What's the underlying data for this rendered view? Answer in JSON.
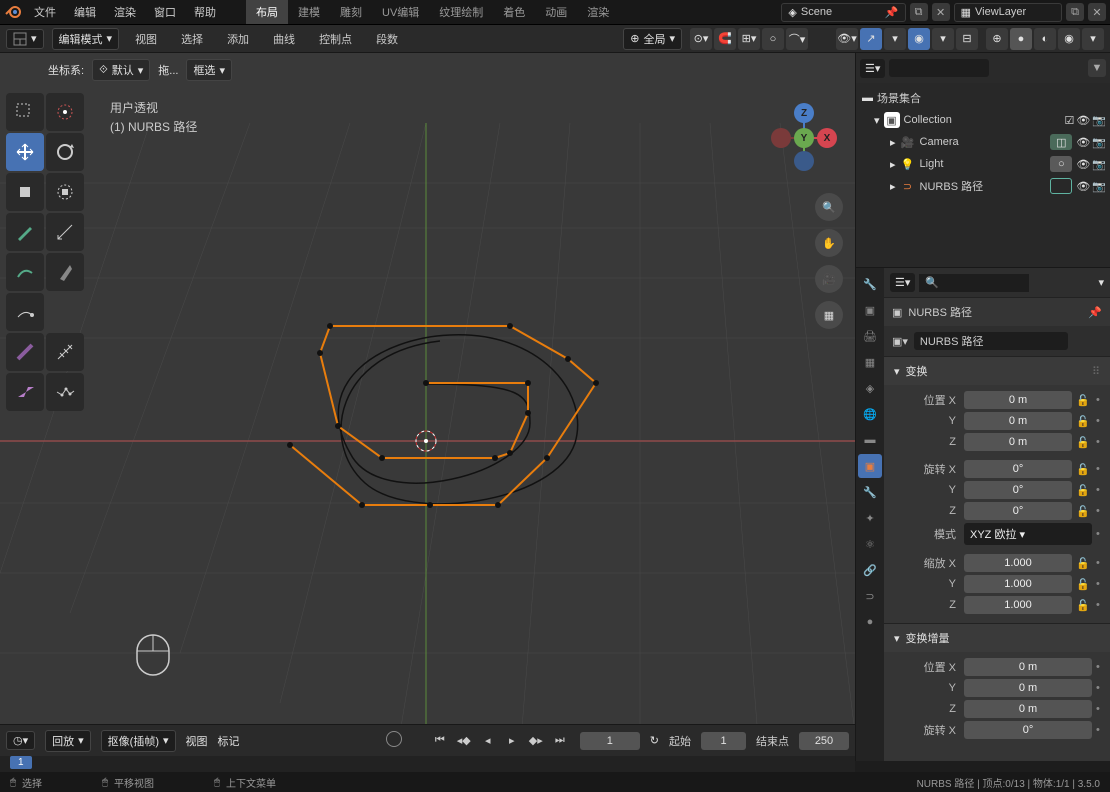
{
  "header": {
    "menu": [
      "文件",
      "编辑",
      "渲染",
      "窗口",
      "帮助"
    ],
    "tabs": [
      "布局",
      "建模",
      "雕刻",
      "UV编辑",
      "纹理绘制",
      "着色",
      "动画",
      "渲染"
    ],
    "active_tab": 0,
    "scene_label": "Scene",
    "viewlayer_label": "ViewLayer"
  },
  "toolbar": {
    "mode": "编辑模式",
    "items": [
      "视图",
      "选择",
      "添加",
      "曲线",
      "控制点",
      "段数"
    ],
    "orientation": "全局",
    "coord_label": "坐标系:",
    "coord_value": "默认",
    "drag_label": "拖...",
    "select_mode": "框选"
  },
  "viewport": {
    "info_line1": "用户透视",
    "info_line2": "(1) NURBS 路径"
  },
  "outliner": {
    "root": "场景集合",
    "collection": "Collection",
    "items": [
      {
        "name": "Camera",
        "icon": "camera",
        "color": "#7fb069"
      },
      {
        "name": "Light",
        "icon": "light",
        "color": "#a0a0a0"
      },
      {
        "name": "NURBS 路径",
        "icon": "curve",
        "color": "#5fb3a1"
      }
    ]
  },
  "properties": {
    "search_placeholder": "",
    "breadcrumb1": "NURBS 路径",
    "breadcrumb2": "NURBS 路径",
    "sections": {
      "transform": "变换",
      "delta": "变换增量"
    },
    "labels": {
      "posX": "位置 X",
      "posY": "Y",
      "posZ": "Z",
      "rotX": "旋转 X",
      "rotY": "Y",
      "rotZ": "Z",
      "mode": "模式",
      "scaleX": "缩放 X",
      "scaleY": "Y",
      "scaleZ": "Z",
      "dposX": "位置 X",
      "dposY": "Y",
      "dposZ": "Z",
      "drotX": "旋转 X"
    },
    "values": {
      "posX": "0 m",
      "posY": "0 m",
      "posZ": "0 m",
      "rotX": "0°",
      "rotY": "0°",
      "rotZ": "0°",
      "mode": "XYZ 欧拉",
      "scaleX": "1.000",
      "scaleY": "1.000",
      "scaleZ": "1.000",
      "dposX": "0 m",
      "dposY": "0 m",
      "dposZ": "0 m",
      "drotX": "0°"
    }
  },
  "timeline": {
    "playback": "回放",
    "keying": "抠像(插帧)",
    "menu": [
      "视图",
      "标记"
    ],
    "current": "1",
    "start_label": "起始",
    "start": "1",
    "end_label": "结束点",
    "end": "250",
    "scrub": "1"
  },
  "statusbar": {
    "select": "选择",
    "pan": "平移视图",
    "context": "上下文菜单",
    "info": "NURBS 路径 | 顶点:0/13 | 物体:1/1 | 3.5.0"
  }
}
